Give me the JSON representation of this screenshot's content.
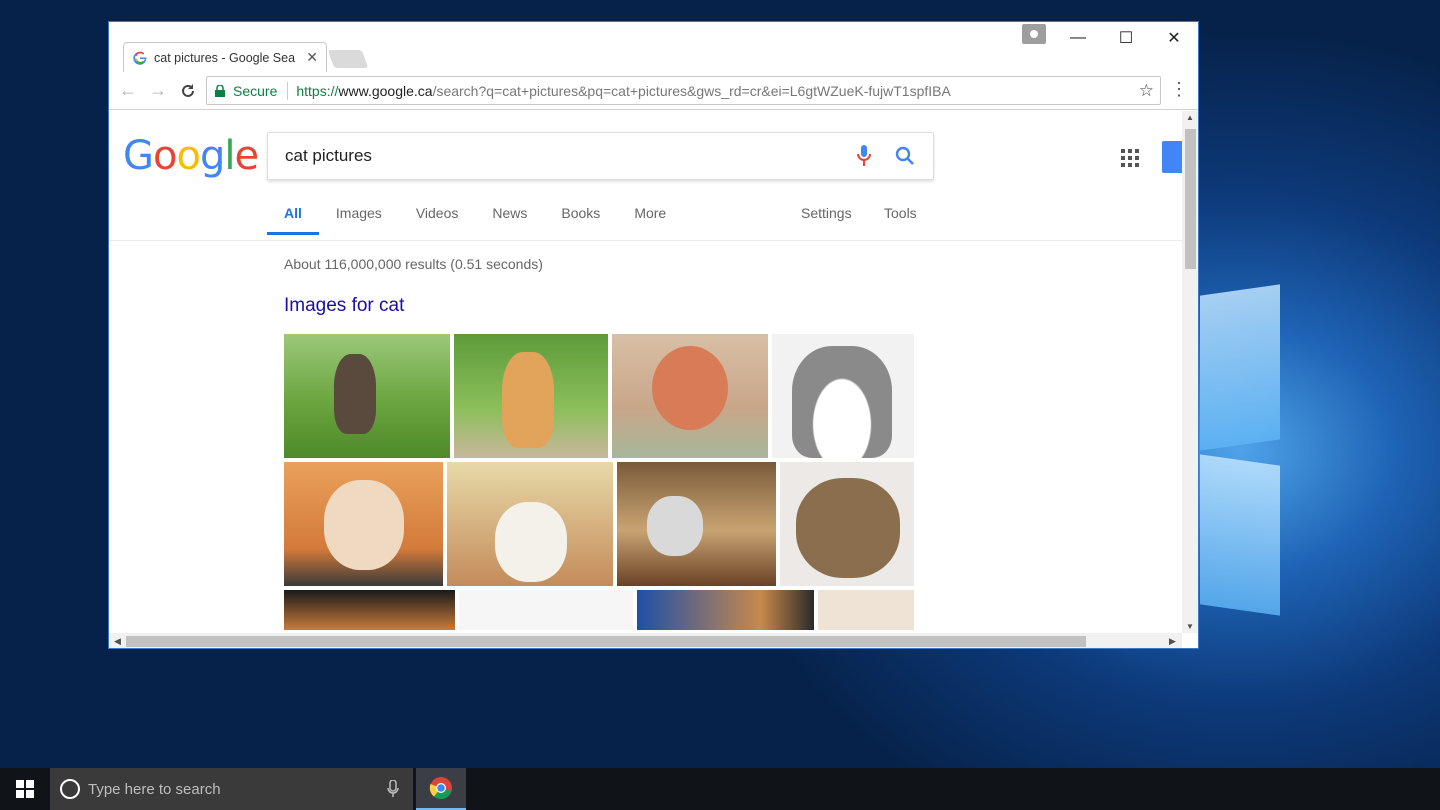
{
  "window": {
    "tab_title": "cat pictures - Google Sea",
    "tab_close": "✕",
    "controls": {
      "minimize": "—",
      "maximize": "☐",
      "close": "✕"
    }
  },
  "toolbar": {
    "secure_label": "Secure",
    "url_scheme": "https://",
    "url_host": "www.google.ca",
    "url_rest": "/search?q=cat+pictures&pq=cat+pictures&gws_rd=cr&ei=L6gtWZueK-fujwT1spfIBA"
  },
  "google": {
    "query": "cat pictures",
    "tabs": [
      "All",
      "Images",
      "Videos",
      "News",
      "Books",
      "More"
    ],
    "settings": "Settings",
    "tools": "Tools",
    "result_stats": "About 116,000,000 results (0.51 seconds)",
    "images_heading": "Images for cat"
  },
  "taskbar": {
    "search_placeholder": "Type here to search"
  },
  "colors": {
    "accent": "#1a73e8",
    "link": "#1a0dab",
    "secure_green": "#0b8043",
    "taskbar": "#101418"
  }
}
